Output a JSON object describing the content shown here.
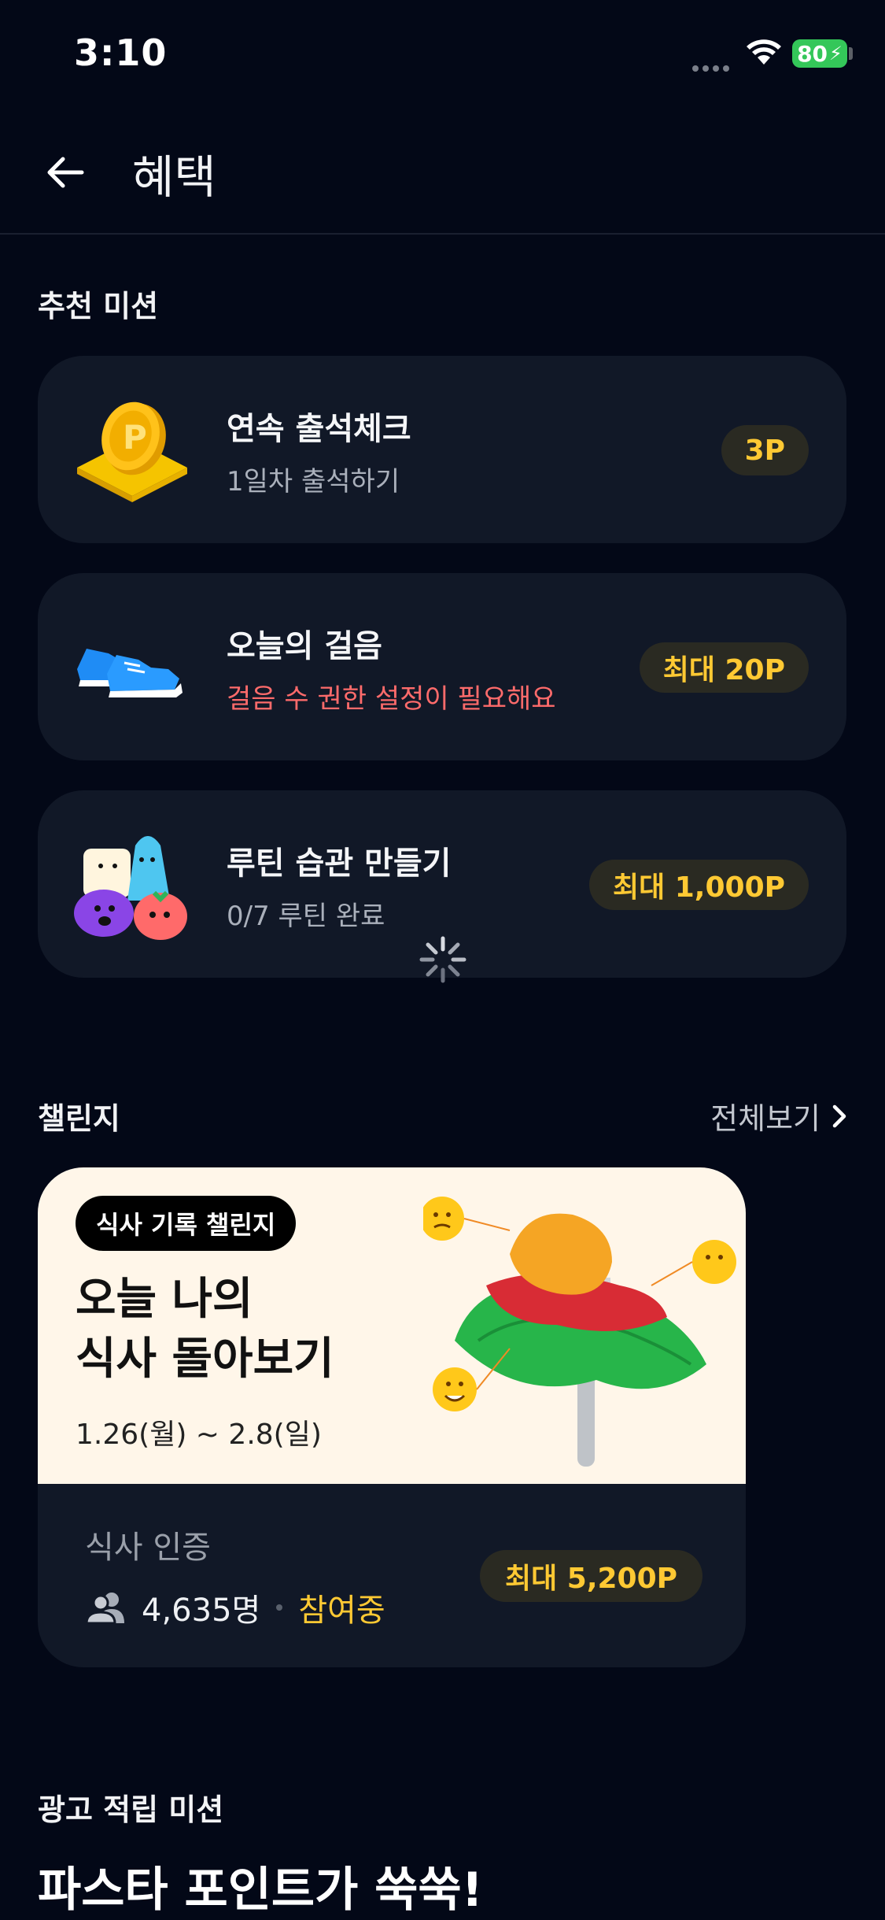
{
  "status_bar": {
    "time": "3:10",
    "battery": "80"
  },
  "header": {
    "title": "혜택"
  },
  "recommended": {
    "title": "추천 미션",
    "missions": [
      {
        "icon": "coin-icon",
        "title": "연속 출석체크",
        "subtitle": "1일차 출석하기",
        "reward": "3P"
      },
      {
        "icon": "shoes-icon",
        "title": "오늘의 걸음",
        "subtitle": "걸음 수 권한 설정이 필요해요",
        "reward": "최대 20P"
      },
      {
        "icon": "routine-characters-icon",
        "title": "루틴 습관 만들기",
        "subtitle": "0/7 루틴 완료",
        "reward": "최대 1,000P"
      }
    ]
  },
  "challenge": {
    "title": "챌린지",
    "see_all": "전체보기",
    "card": {
      "tag": "식사 기록 챌린지",
      "headline_line1": "오늘 나의",
      "headline_line2": "식사 돌아보기",
      "period": "1.26(월) ~ 2.8(일)",
      "verify": "식사 인증",
      "participants": "4,635명",
      "status": "참여중",
      "reward": "최대 5,200P"
    }
  },
  "ad_missions": {
    "title": "광고 적립 미션",
    "headline": "파스타 포인트가 쑥쑥!"
  },
  "colors": {
    "background": "#030817",
    "card": "#111827",
    "accent": "#ffc933",
    "warning": "#ff6b6b",
    "battery": "#34c759"
  }
}
